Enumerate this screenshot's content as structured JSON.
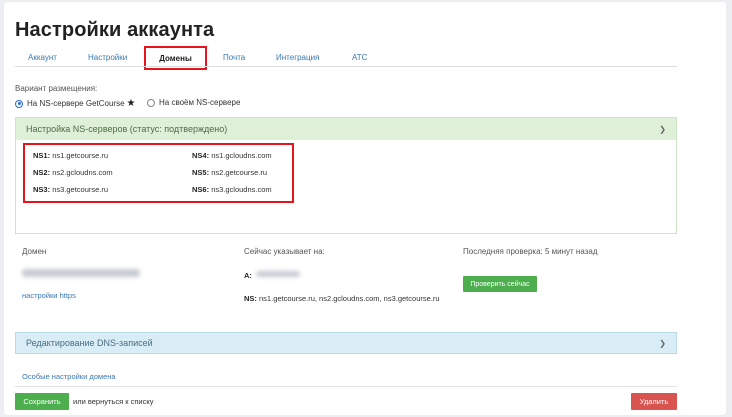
{
  "page": {
    "title": "Настройки аккаунта"
  },
  "tabs": [
    {
      "label": "Аккаунт"
    },
    {
      "label": "Настройки"
    },
    {
      "label": "Домены"
    },
    {
      "label": "Почта"
    },
    {
      "label": "Интеграция"
    },
    {
      "label": "АТС"
    }
  ],
  "placement": {
    "label": "Вариант размещения:",
    "option_getcourse": "На NS-сервере GetCourse",
    "option_own": "На своём NS-сервере"
  },
  "ns_panel": {
    "title": "Настройка NS-серверов (статус: подтверждено)",
    "servers": [
      {
        "key": "NS1:",
        "value": "ns1.getcourse.ru"
      },
      {
        "key": "NS2:",
        "value": "ns2.gcloudns.com"
      },
      {
        "key": "NS3:",
        "value": "ns3.getcourse.ru"
      },
      {
        "key": "NS4:",
        "value": "ns1.gcloudns.com"
      },
      {
        "key": "NS5:",
        "value": "ns2.getcourse.ru"
      },
      {
        "key": "NS6:",
        "value": "ns3.gcloudns.com"
      }
    ]
  },
  "domain_table": {
    "col_domain": "Домен",
    "col_points": "Сейчас указывает на:",
    "col_check": "Последняя проверка: 5 минут назад",
    "https_link": "настройки https",
    "a_label": "A:",
    "ns_label": "NS:",
    "ns_value": "ns1.getcourse.ru, ns2.gcloudns.com, ns3.getcourse.ru",
    "check_button": "Проверить сейчас"
  },
  "dns_panel": {
    "title": "Редактирование DNS-записей"
  },
  "footer": {
    "special_link": "Особые настройки домена",
    "save_button": "Сохранить",
    "back_text": "или вернуться к списку",
    "delete_button": "Удалить"
  },
  "colors": {
    "highlight_red": "#e8141d",
    "link_blue": "#3a78b5",
    "green_button": "#4cae4c",
    "red_button": "#d9534f"
  }
}
